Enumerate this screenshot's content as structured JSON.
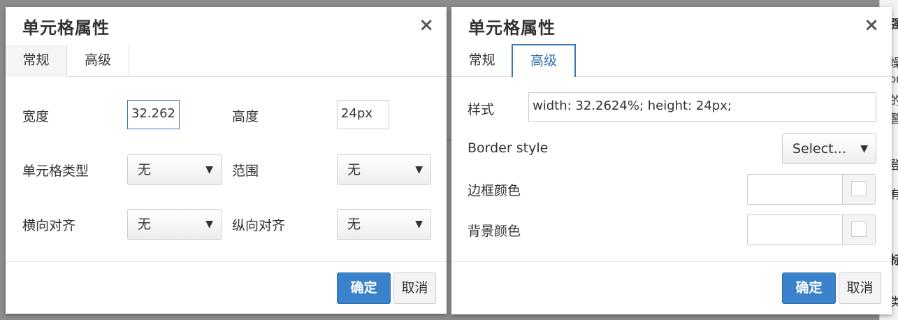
{
  "dialog_left": {
    "title": "单元格属性",
    "close": "×",
    "tabs": [
      "常规",
      "高级"
    ],
    "width_label": "宽度",
    "width_value": "32.262",
    "height_label": "高度",
    "height_value": "24px",
    "cell_type_label": "单元格类型",
    "cell_type_value": "无",
    "scope_label": "范围",
    "scope_value": "无",
    "h_align_label": "横向对齐",
    "h_align_value": "无",
    "v_align_label": "纵向对齐",
    "v_align_value": "无",
    "ok": "确定",
    "cancel": "取消"
  },
  "dialog_right": {
    "title": "单元格属性",
    "close": "×",
    "tabs": [
      "常规",
      "高级"
    ],
    "style_label": "样式",
    "style_value": "width: 32.2624%; height: 24px;",
    "border_style_label": "Border style",
    "border_style_value": "Select...",
    "border_color_label": "边框颜色",
    "bg_color_label": "背景颜色",
    "ok": "确定",
    "cancel": "取消"
  },
  "background_chars": [
    "强",
    "燥",
    "on",
    "的",
    "警",
    "登",
    "有",
    "标",
    "类"
  ],
  "colors": {
    "primary": "#3a83cc",
    "active_tab": "#2f6fae"
  }
}
